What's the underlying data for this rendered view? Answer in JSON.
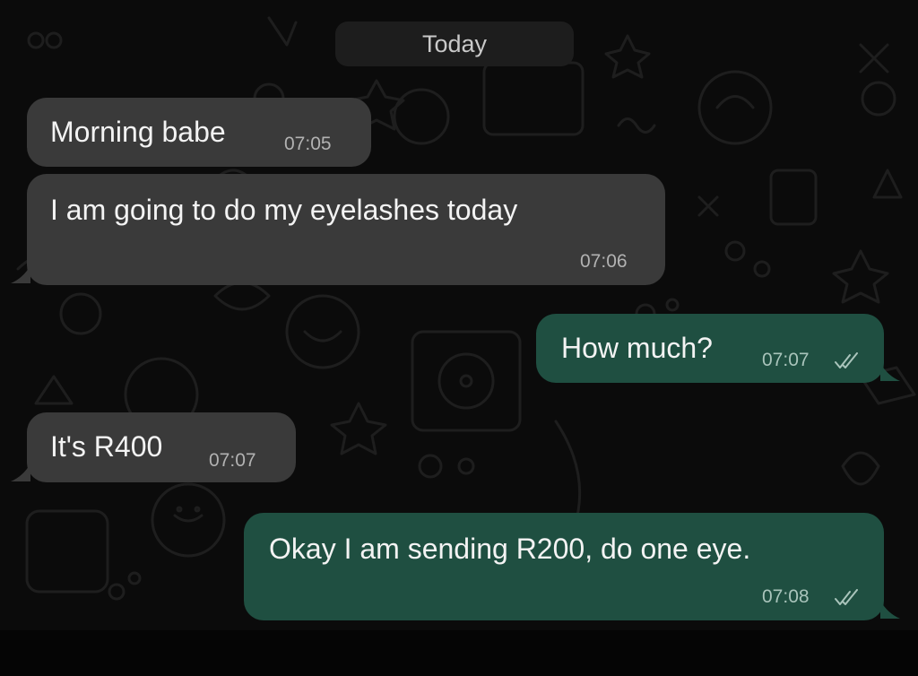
{
  "chat": {
    "date_separator": "Today",
    "messages": [
      {
        "direction": "incoming",
        "text": "Morning babe",
        "time": "07:05"
      },
      {
        "direction": "incoming",
        "text": "I am going to do my eyelashes today",
        "time": "07:06"
      },
      {
        "direction": "outgoing",
        "text": "How much?",
        "time": "07:07",
        "status_icon": "double-check-icon"
      },
      {
        "direction": "incoming",
        "text": "It's R400",
        "time": "07:07"
      },
      {
        "direction": "outgoing",
        "text": "Okay I am sending R200, do one eye.",
        "time": "07:08",
        "status_icon": "double-check-icon"
      }
    ]
  },
  "colors": {
    "background": "#0b0b0b",
    "incoming_bubble": "#3a3a3a",
    "outgoing_bubble": "#1f4f41",
    "date_pill": "#1d1d1d"
  }
}
